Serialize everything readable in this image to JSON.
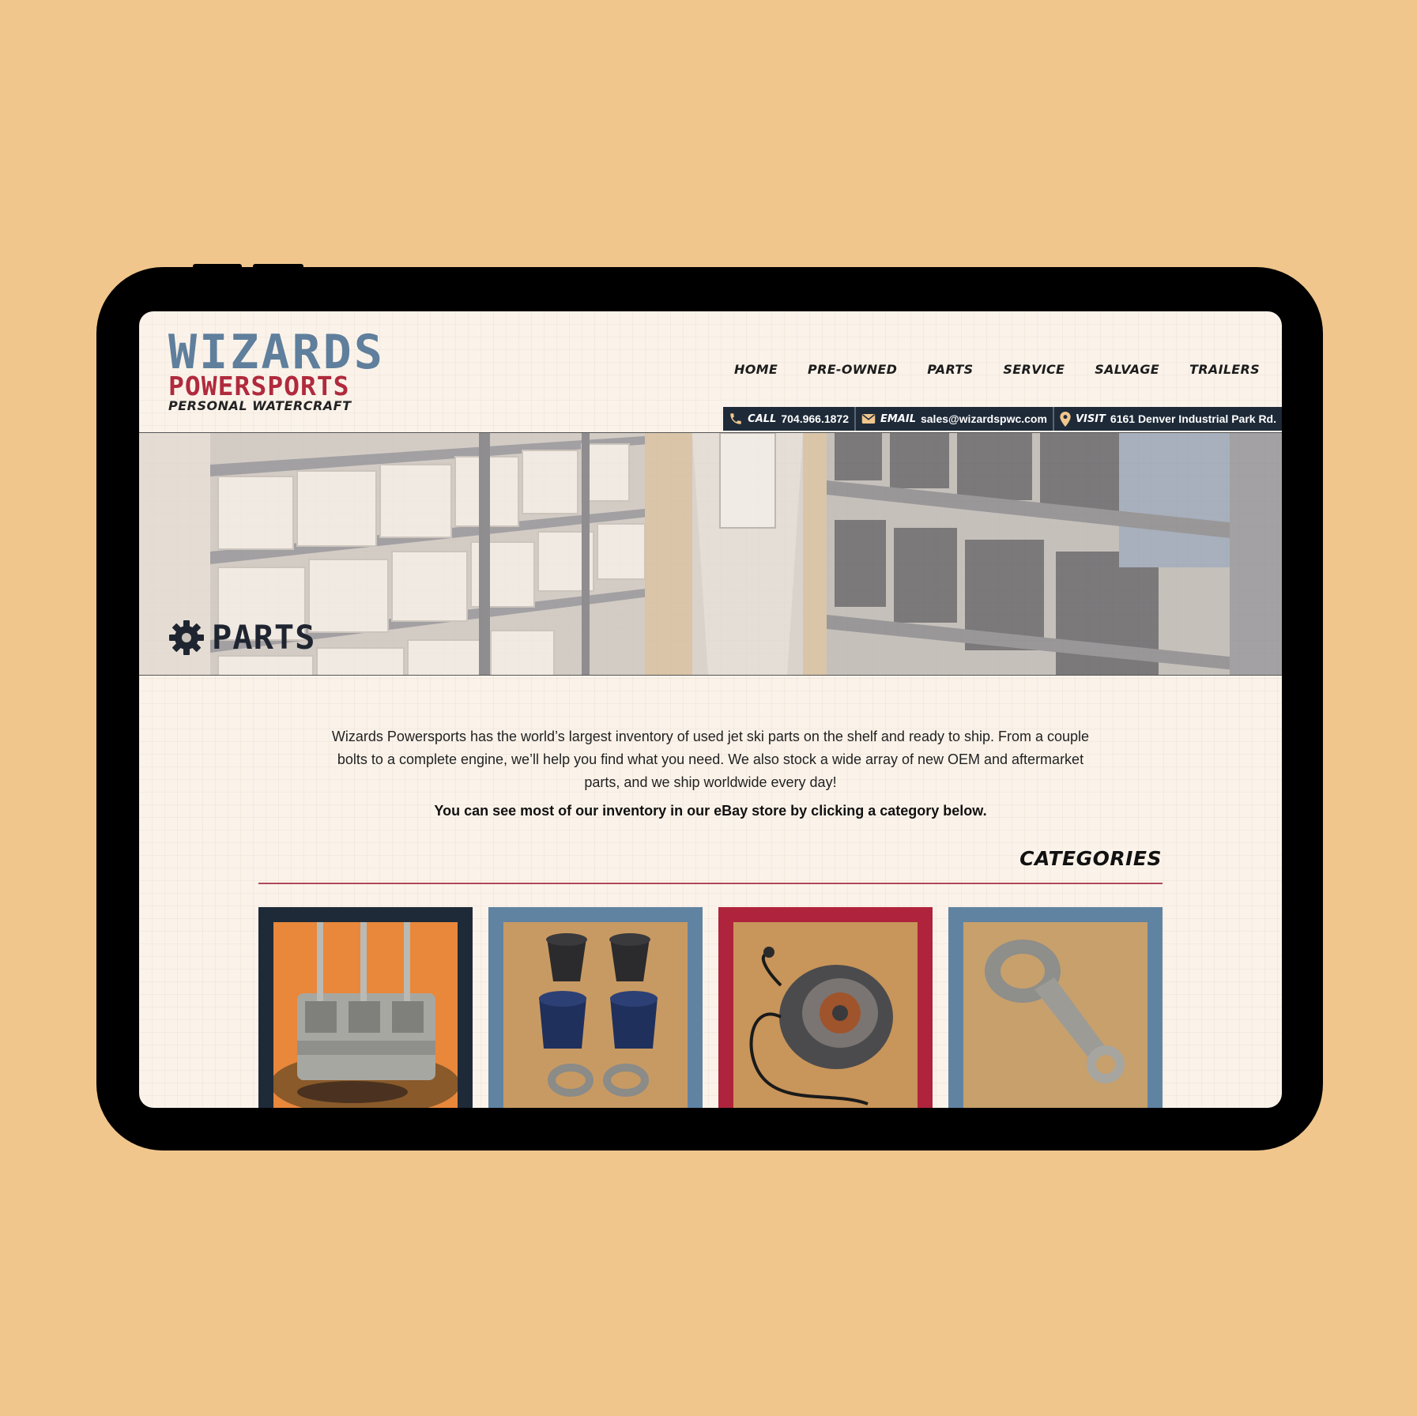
{
  "logo": {
    "line1": "WIZARDS",
    "line2": "POWERSPORTS",
    "line3": "PERSONAL WATERCRAFT"
  },
  "nav": [
    "HOME",
    "PRE-OWNED",
    "PARTS",
    "SERVICE",
    "SALVAGE",
    "TRAILERS"
  ],
  "contact": {
    "call_label": "CALL",
    "call_value": "704.966.1872",
    "email_label": "EMAIL",
    "email_value": "sales@wizardspwc.com",
    "visit_label": "VISIT",
    "visit_value": "6161 Denver Industrial Park Rd."
  },
  "hero": {
    "title": "PARTS",
    "icon": "gear-icon"
  },
  "intro_text": "Wizards Powersports has the world’s largest inventory of used jet ski parts on the shelf and ready to ship. From a couple bolts to a complete engine, we’ll help you find what you need. We also stock a wide array of new OEM and aftermarket parts, and we ship worldwide every day!",
  "cta_text": "You can see most of our inventory in our eBay store by clicking a category below.",
  "categories_heading": "CATEGORIES",
  "cards": [
    {
      "image": "engine-block",
      "border_color": "#1e2a38"
    },
    {
      "image": "air-filters",
      "border_color": "#6183a2"
    },
    {
      "image": "stator",
      "border_color": "#b0233c"
    },
    {
      "image": "connecting-rod",
      "border_color": "#6183a2"
    }
  ],
  "colors": {
    "page_bg": "#f0c68c",
    "brand_blue": "#5f7f9c",
    "brand_red": "#b02a3d",
    "dark": "#1e2a38"
  }
}
